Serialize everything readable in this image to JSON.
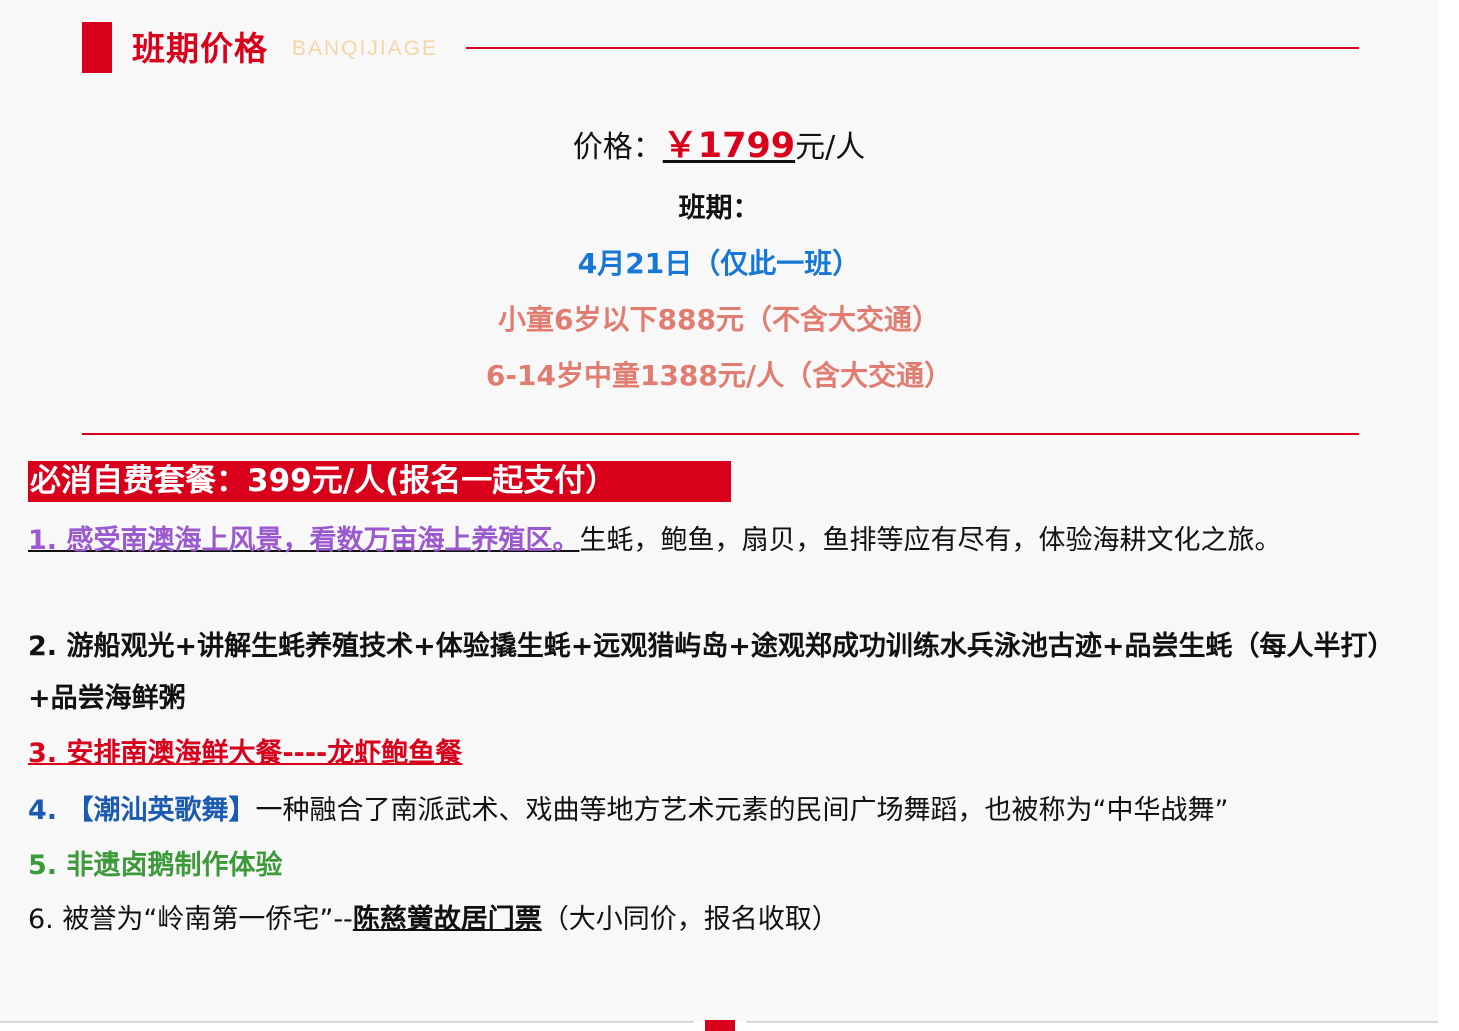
{
  "section": {
    "title": "班期价格",
    "subtitle": "BANQIJIAGE"
  },
  "price": {
    "label": "价格：",
    "amount": "￥1799",
    "unit": "元/人"
  },
  "schedule": {
    "label": "班期：",
    "date": "4月21日（仅此一班）",
    "child_under6": "小童6岁以下888元（不含大交通）",
    "child_6_14": "6-14岁中童1388元/人（含大交通）"
  },
  "mandatory_package": "必消自费套餐：399元/人(报名一起支付）",
  "items": {
    "item1_highlight": "1. 感受南澳海上风景，看数万亩海上养殖区。",
    "item1_rest": "生蚝，鲍鱼，扇贝，鱼排等应有尽有，体验海耕文化之旅。",
    "item2": "2. 游船观光+讲解生蚝养殖技术+体验撬生蚝+远观猎屿岛+途观郑成功训练水兵泳池古迹+品尝生蚝（每人半打） +品尝海鲜粥",
    "item3": "3. 安排南澳海鲜大餐----龙虾鲍鱼餐",
    "item4_prefix": "4. ",
    "item4_highlight": "【潮汕英歌舞】",
    "item4_rest": "一种融合了南派武术、戏曲等地方艺术元素的民间广场舞蹈，也被称为“中华战舞”",
    "item5": "5. 非遗卤鹅制作体验",
    "item6_prefix": "6. 被誉为“岭南第一侨宅”--",
    "item6_highlight": "陈慈黉故居门票",
    "item6_rest": "（大小同价，报名收取）"
  },
  "colors": {
    "brand_red": "#d9001b",
    "date_blue": "#1677d6",
    "child_salmon": "#e07d70",
    "item1_purple": "#9b59d0",
    "item4_blue": "#1a5ab0",
    "item5_green": "#3d9a3a"
  }
}
